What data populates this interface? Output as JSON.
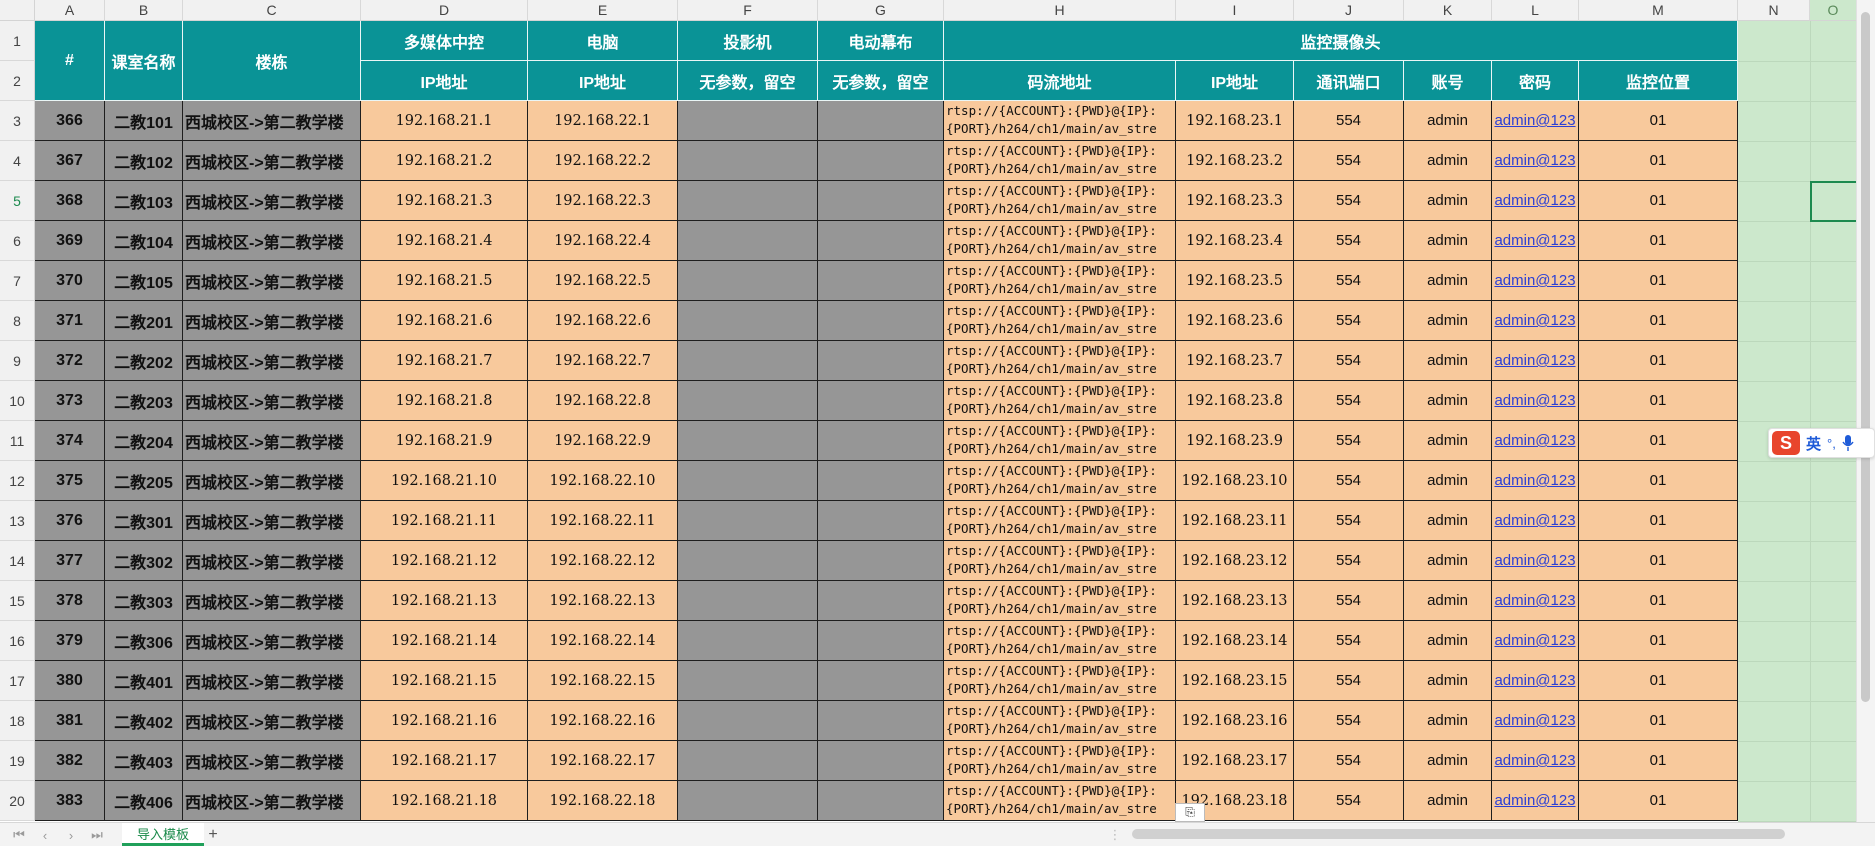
{
  "columns": [
    "A",
    "B",
    "C",
    "D",
    "E",
    "F",
    "G",
    "H",
    "I",
    "J",
    "K",
    "L",
    "M",
    "N",
    "O"
  ],
  "header_row1": {
    "hash": "#",
    "room": "课室名称",
    "building": "楼栋",
    "media": "多媒体中控",
    "pc": "电脑",
    "projector": "投影机",
    "screen": "电动幕布",
    "camera": "监控摄像头"
  },
  "header_row2": {
    "media_ip": "IP地址",
    "pc_ip": "IP地址",
    "projector_note": "无参数，留空",
    "screen_note": "无参数，留空",
    "stream": "码流地址",
    "cam_ip": "IP地址",
    "port": "通讯端口",
    "account": "账号",
    "password": "密码",
    "position": "监控位置"
  },
  "row_numbers": [
    "1",
    "2",
    "3",
    "4",
    "5",
    "6",
    "7",
    "8",
    "9",
    "10",
    "11",
    "12",
    "13",
    "14",
    "15",
    "16",
    "17",
    "18",
    "19",
    "20"
  ],
  "rows": [
    {
      "id": "366",
      "room": "二教101",
      "building": "西城校区->第二教学楼",
      "media_ip": "192.168.21.1",
      "pc_ip": "192.168.22.1",
      "cam_ip": "192.168.23.1"
    },
    {
      "id": "367",
      "room": "二教102",
      "building": "西城校区->第二教学楼",
      "media_ip": "192.168.21.2",
      "pc_ip": "192.168.22.2",
      "cam_ip": "192.168.23.2"
    },
    {
      "id": "368",
      "room": "二教103",
      "building": "西城校区->第二教学楼",
      "media_ip": "192.168.21.3",
      "pc_ip": "192.168.22.3",
      "cam_ip": "192.168.23.3"
    },
    {
      "id": "369",
      "room": "二教104",
      "building": "西城校区->第二教学楼",
      "media_ip": "192.168.21.4",
      "pc_ip": "192.168.22.4",
      "cam_ip": "192.168.23.4"
    },
    {
      "id": "370",
      "room": "二教105",
      "building": "西城校区->第二教学楼",
      "media_ip": "192.168.21.5",
      "pc_ip": "192.168.22.5",
      "cam_ip": "192.168.23.5"
    },
    {
      "id": "371",
      "room": "二教201",
      "building": "西城校区->第二教学楼",
      "media_ip": "192.168.21.6",
      "pc_ip": "192.168.22.6",
      "cam_ip": "192.168.23.6"
    },
    {
      "id": "372",
      "room": "二教202",
      "building": "西城校区->第二教学楼",
      "media_ip": "192.168.21.7",
      "pc_ip": "192.168.22.7",
      "cam_ip": "192.168.23.7"
    },
    {
      "id": "373",
      "room": "二教203",
      "building": "西城校区->第二教学楼",
      "media_ip": "192.168.21.8",
      "pc_ip": "192.168.22.8",
      "cam_ip": "192.168.23.8"
    },
    {
      "id": "374",
      "room": "二教204",
      "building": "西城校区->第二教学楼",
      "media_ip": "192.168.21.9",
      "pc_ip": "192.168.22.9",
      "cam_ip": "192.168.23.9"
    },
    {
      "id": "375",
      "room": "二教205",
      "building": "西城校区->第二教学楼",
      "media_ip": "192.168.21.10",
      "pc_ip": "192.168.22.10",
      "cam_ip": "192.168.23.10"
    },
    {
      "id": "376",
      "room": "二教301",
      "building": "西城校区->第二教学楼",
      "media_ip": "192.168.21.11",
      "pc_ip": "192.168.22.11",
      "cam_ip": "192.168.23.11"
    },
    {
      "id": "377",
      "room": "二教302",
      "building": "西城校区->第二教学楼",
      "media_ip": "192.168.21.12",
      "pc_ip": "192.168.22.12",
      "cam_ip": "192.168.23.12"
    },
    {
      "id": "378",
      "room": "二教303",
      "building": "西城校区->第二教学楼",
      "media_ip": "192.168.21.13",
      "pc_ip": "192.168.22.13",
      "cam_ip": "192.168.23.13"
    },
    {
      "id": "379",
      "room": "二教306",
      "building": "西城校区->第二教学楼",
      "media_ip": "192.168.21.14",
      "pc_ip": "192.168.22.14",
      "cam_ip": "192.168.23.14"
    },
    {
      "id": "380",
      "room": "二教401",
      "building": "西城校区->第二教学楼",
      "media_ip": "192.168.21.15",
      "pc_ip": "192.168.22.15",
      "cam_ip": "192.168.23.15"
    },
    {
      "id": "381",
      "room": "二教402",
      "building": "西城校区->第二教学楼",
      "media_ip": "192.168.21.16",
      "pc_ip": "192.168.22.16",
      "cam_ip": "192.168.23.16"
    },
    {
      "id": "382",
      "room": "二教403",
      "building": "西城校区->第二教学楼",
      "media_ip": "192.168.21.17",
      "pc_ip": "192.168.22.17",
      "cam_ip": "192.168.23.17"
    },
    {
      "id": "383",
      "room": "二教406",
      "building": "西城校区->第二教学楼",
      "media_ip": "192.168.21.18",
      "pc_ip": "192.168.22.18",
      "cam_ip": "192.168.23.18"
    }
  ],
  "common": {
    "stream_line1": "rtsp://{ACCOUNT}:{PWD}@{IP}:",
    "stream_line2": "{PORT}/h264/ch1/main/av_stre",
    "port": "554",
    "account": "admin",
    "password": "admin@123",
    "position": "01"
  },
  "colors": {
    "header_teal": "#0a9396",
    "gray_cells": "#969696",
    "peach_cells": "#f8c99c",
    "outside_area": "#cce8cc",
    "link_blue": "#2b3fd6",
    "tab_green": "#1a8a4a"
  },
  "tabbar": {
    "sheet_tab": "导入模板",
    "add_tab": "+"
  },
  "ime": {
    "logo": "S",
    "mode": "英",
    "punct": "°,"
  },
  "paste_options": "⎘"
}
